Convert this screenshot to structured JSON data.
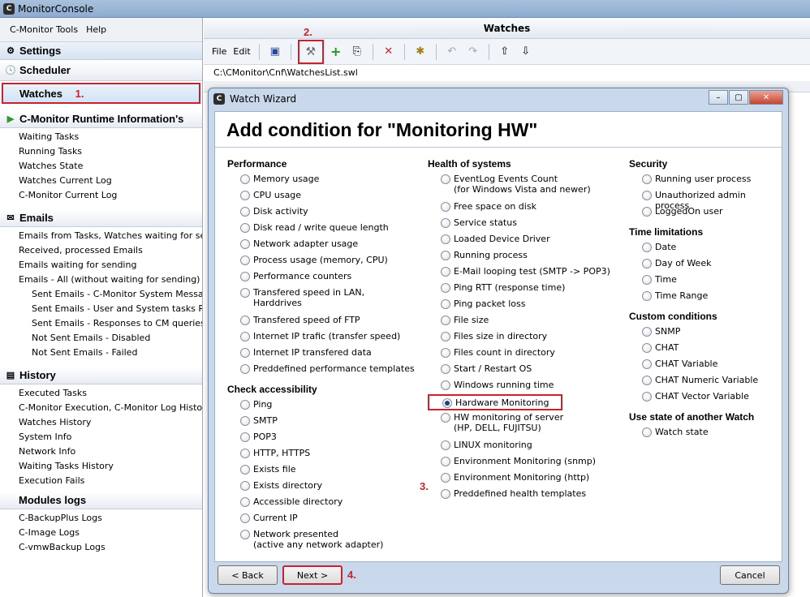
{
  "app": {
    "title": "MonitorConsole"
  },
  "menu": [
    "C-Monitor Tools",
    "Help"
  ],
  "sidebar": {
    "settings": "Settings",
    "scheduler": "Scheduler",
    "watches": "Watches",
    "runtime": {
      "title": "C-Monitor Runtime Information's",
      "items": [
        "Waiting Tasks",
        "Running Tasks",
        "Watches State",
        "Watches Current Log",
        "C-Monitor Current Log"
      ]
    },
    "emails": {
      "title": "Emails",
      "items": [
        "Emails from Tasks, Watches waiting for sending",
        "Received, processed Emails",
        "Emails waiting for sending",
        "Emails - All (without waiting for sending)"
      ],
      "sub_items": [
        "Sent Emails - C-Monitor System Messages",
        "Sent Emails - User and System tasks Results",
        "Sent Emails - Responses to CM queries",
        "Not Sent Emails - Disabled",
        "Not Sent Emails - Failed"
      ]
    },
    "history": {
      "title": "History",
      "items": [
        "Executed Tasks",
        "C-Monitor Execution, C-Monitor Log History",
        "Watches History",
        "System Info",
        "Network Info",
        "Waiting Tasks History",
        "Execution Fails"
      ]
    },
    "modules": {
      "title": "Modules logs",
      "items": [
        "C-BackupPlus Logs",
        "C-Image Logs",
        "C-vmwBackup Logs"
      ]
    }
  },
  "watches_panel": {
    "title": "Watches",
    "toolbar": {
      "file": "File",
      "edit": "Edit"
    },
    "path": "C:\\CMonitor\\Cnf\\WatchesList.swl"
  },
  "callouts": {
    "step1": "1.",
    "step2": "2.",
    "step3": "3.",
    "step4": "4."
  },
  "wizard": {
    "title": "Watch Wizard",
    "heading": "Add condition for \"Monitoring HW\"",
    "performance": {
      "title": "Performance",
      "options": [
        "Memory usage",
        "CPU usage",
        "Disk activity",
        "Disk read / write queue length",
        "Network adapter usage",
        "Process usage (memory, CPU)",
        "Performance counters",
        "Transfered speed in LAN,\nHarddrives",
        "Transfered speed of FTP",
        "Internet IP trafic (transfer speed)",
        "Internet IP transfered data",
        "Preddefined performance templates"
      ]
    },
    "accessibility": {
      "title": "Check accessibility",
      "options": [
        "Ping",
        "SMTP",
        "POP3",
        "HTTP, HTTPS",
        "Exists file",
        "Exists directory",
        "Accessible directory",
        "Current IP",
        "Network presented\n(active any network adapter)"
      ]
    },
    "health": {
      "title": "Health of systems",
      "options": [
        "EventLog Events Count\n(for Windows Vista and newer)",
        "Free space on disk",
        "Service status",
        "Loaded Device Driver",
        "Running process",
        "E-Mail looping test (SMTP -> POP3)",
        "Ping RTT (response time)",
        "Ping packet loss",
        "File size",
        "Files size in directory",
        "Files count in directory",
        "Start / Restart OS",
        "Windows running time",
        "Hardware Monitoring",
        "HW monitoring of server\n(HP, DELL, FUJITSU)",
        "LINUX monitoring",
        "Environment Monitoring (snmp)",
        "Environment Monitoring (http)",
        "Preddefined health templates"
      ],
      "selected": "Hardware Monitoring"
    },
    "security": {
      "title": "Security",
      "options": [
        "Running user process",
        "Unauthorized admin process",
        "LoggedOn user"
      ]
    },
    "time": {
      "title": "Time limitations",
      "options": [
        "Date",
        "Day of Week",
        "Time",
        "Time Range"
      ]
    },
    "custom": {
      "title": "Custom conditions",
      "options": [
        "SNMP",
        "CHAT",
        "CHAT Variable",
        "CHAT Numeric Variable",
        "CHAT Vector Variable"
      ]
    },
    "another": {
      "title": "Use state of another Watch",
      "options": [
        "Watch state"
      ]
    },
    "buttons": {
      "back": "< Back",
      "next": "Next >",
      "cancel": "Cancel"
    }
  }
}
